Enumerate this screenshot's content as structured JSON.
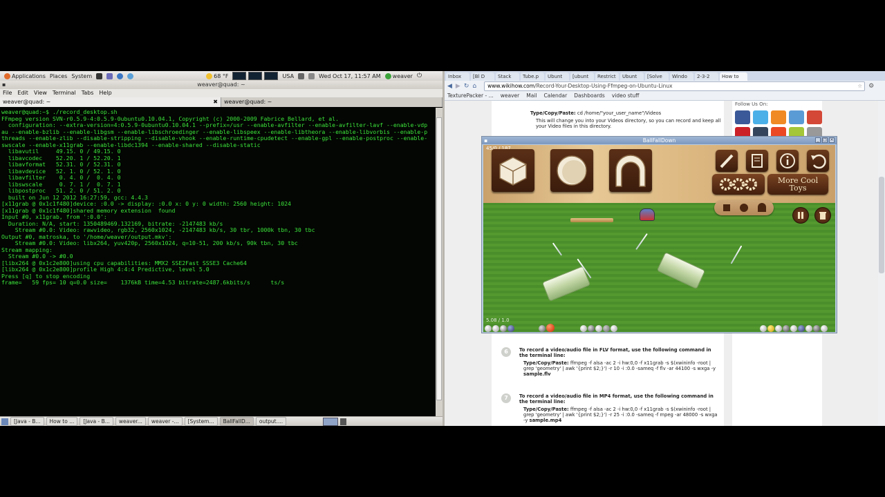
{
  "panel": {
    "applications": "Applications",
    "places": "Places",
    "system": "System",
    "temperature": "68 °F",
    "keyboard": "USA",
    "datetime": "Wed Oct 17, 11:57 AM",
    "user": "weaver"
  },
  "terminal": {
    "title": "weaver@quad: ~",
    "menu": [
      "File",
      "Edit",
      "View",
      "Terminal",
      "Tabs",
      "Help"
    ],
    "tabs": [
      "weaver@quad: ~",
      "weaver@quad: ~"
    ],
    "close_glyph": "✖",
    "lines": [
      "weaver@quad:~$ ./record_desktop.sh",
      "FFmpeg version SVN-r0.5.9-4:0.5.9-0ubuntu0.10.04.1, Copyright (c) 2000-2009 Fabrice Bellard, et al.",
      "  configuration: --extra-version=4:0.5.9-0ubuntu0.10.04.1 --prefix=/usr --enable-avfilter --enable-avfilter-lavf --enable-vdp",
      "au --enable-bzlib --enable-libgsm --enable-libschroedinger --enable-libspeex --enable-libtheora --enable-libvorbis --enable-p",
      "threads --enable-zlib --disable-stripping --disable-vhook --enable-runtime-cpudetect --enable-gpl --enable-postproc --enable-",
      "swscale --enable-x11grab --enable-libdc1394 --enable-shared --disable-static",
      "  libavutil     49.15. 0 / 49.15. 0",
      "  libavcodec    52.20. 1 / 52.20. 1",
      "  libavformat   52.31. 0 / 52.31. 0",
      "  libavdevice   52. 1. 0 / 52. 1. 0",
      "  libavfilter    0. 4. 0 /  0. 4. 0",
      "  libswscale     0. 7. 1 /  0. 7. 1",
      "  libpostproc   51. 2. 0 / 51. 2. 0",
      "  built on Jun 12 2012 16:27:59, gcc: 4.4.3",
      "[x11grab @ 0x1c1f480]device: :0.0 -> display: :0.0 x: 0 y: 0 width: 2560 height: 1024",
      "[x11grab @ 0x1c1f480]shared memory extension  found",
      "Input #0, x11grab, from ':0.0':",
      "  Duration: N/A, start: 1350489469.132169, bitrate: -2147483 kb/s",
      "    Stream #0.0: Video: rawvideo, rgb32, 2560x1024, -2147483 kb/s, 30 tbr, 1000k tbn, 30 tbc",
      "Output #0, matroska, to '/home/weaver/output.mkv':",
      "    Stream #0.0: Video: libx264, yuv420p, 2560x1024, q=10-51, 200 kb/s, 90k tbn, 30 tbc",
      "Stream mapping:",
      "  Stream #0.0 -> #0.0",
      "[libx264 @ 0x1c2e800]using cpu capabilities: MMX2 SSE2Fast SSSE3 Cache64",
      "[libx264 @ 0x1c2e800]profile High 4:4:4 Predictive, level 5.0",
      "Press [q] to stop encoding",
      "frame=   59 fps= 10 q=0.0 size=    1376kB time=4.53 bitrate=2487.6kbits/s      ts/s"
    ]
  },
  "taskbar": [
    "[Java - B...",
    "How to ...",
    "[Java - B...",
    "weaver...",
    "weaver -...",
    "[System...",
    "BallFallD...",
    "output...."
  ],
  "browser": {
    "tabs": [
      "Inbox",
      "[Bl D",
      "Stack",
      "Tube.p",
      "Ubunt",
      "[ubunt",
      "Restrict",
      "Ubunt",
      "[Solve",
      "Windo",
      "2-3-2",
      "How to"
    ],
    "url_host": "www.wikihow.com",
    "url_path": "/Record-Your-Desktop-Using-Ffmpeg-on-Ubuntu-Linux",
    "bookmarks": [
      "TexturePacker - ...",
      "weaver",
      "Mail",
      "Calendar",
      "Dashboards",
      "video stuff"
    ],
    "step_top": {
      "label": "Type/Copy/Paste:",
      "code": "cd /home/\"your_user_name\"/Videos",
      "note": "This will change you into your Videos directory, so you can record and keep all your Video files in this directory."
    },
    "step6": {
      "num": "6",
      "heading": "To record a video/audio file in FLV format, use the following command in the terminal line:",
      "label": "Type/Copy/Paste:",
      "code": "ffmpeg -f alsa -ac 2 -i hw:0,0 -f x11grab -s $(xwininfo -root | grep 'geometry' | awk '{print $2;}') -r 10 -i :0.0 -sameq -f flv -ar 44100 -s wxga -y",
      "file": "sample.flv"
    },
    "step7": {
      "num": "7",
      "heading": "To record a video/audio file in MP4 format, use the following command in the terminal line:",
      "label": "Type/Copy/Paste:",
      "code": "ffmpeg -f alsa -ac 2 -i hw:0,0 -f x11grab -s $(xwininfo -root | grep 'geometry' | awk '{print $2;}') -r 25 -i :0.0 -sameq -f mpeg -ar 48000 -s wxga -y",
      "file": "sample.mp4"
    },
    "social_heading": "Follow Us On:"
  },
  "game": {
    "title": "BallFallDown",
    "more_label_1": "More Cool",
    "more_label_2": "Toys",
    "top_score": "45/0 / 187",
    "bottom_score": "5.08 / 1.0"
  },
  "colors": {
    "terminal_fg": "#3ce33a",
    "terminal_bg": "#030603",
    "wood": "#dcb780",
    "grass": "#4f942d"
  }
}
